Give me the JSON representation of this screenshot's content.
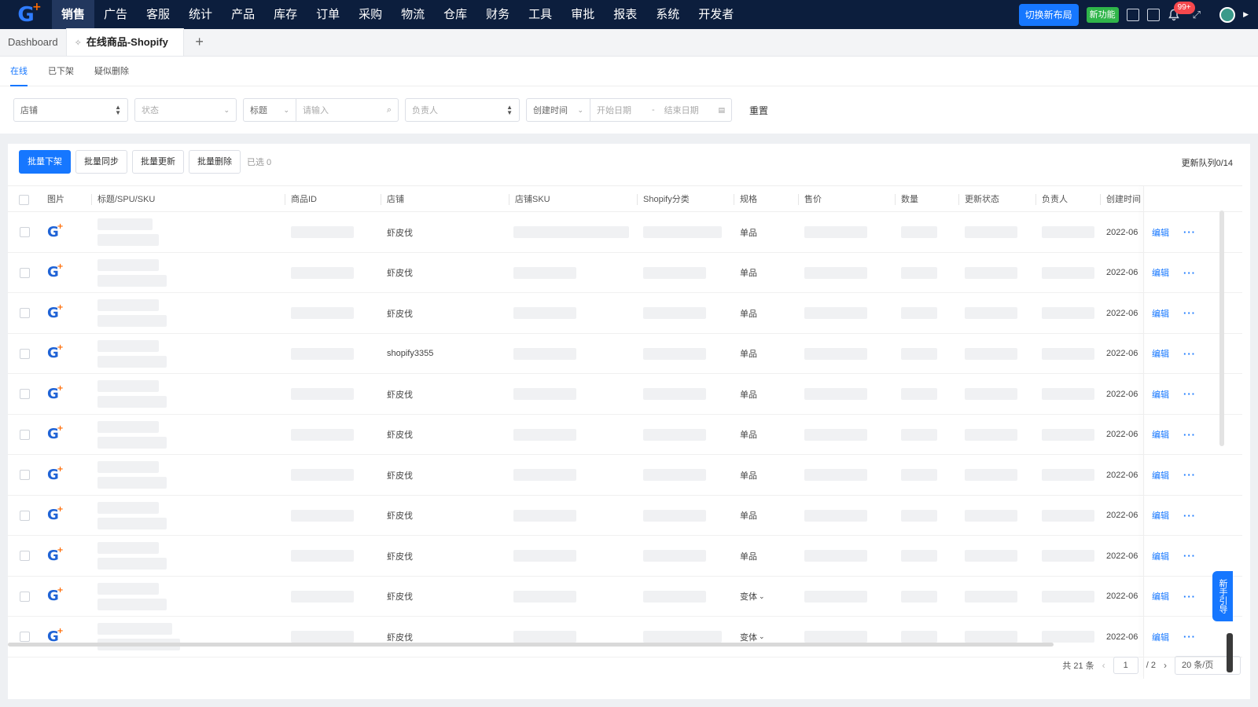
{
  "topnav": {
    "logo_text": "G",
    "menu": [
      "销售",
      "广告",
      "客服",
      "统计",
      "产品",
      "库存",
      "订单",
      "采购",
      "物流",
      "仓库",
      "财务",
      "工具",
      "审批",
      "报表",
      "系统",
      "开发者"
    ],
    "active_menu": "销售",
    "switch_layout": "切换新布局",
    "new_feature": "新功能",
    "notification_badge": "99+"
  },
  "tabs": {
    "dashboard": "Dashboard",
    "current": "在线商品-Shopify",
    "add": "+"
  },
  "subtabs": [
    "在线",
    "已下架",
    "疑似删除"
  ],
  "filters": {
    "store": "店铺",
    "status_placeholder": "状态",
    "title_select": "标题",
    "search_placeholder": "请输入",
    "owner": "负责人",
    "time_type": "创建时间",
    "start_date": "开始日期",
    "date_sep": "-",
    "end_date": "结束日期",
    "reset": "重置"
  },
  "toolbar": {
    "batch_offline": "批量下架",
    "batch_sync": "批量同步",
    "batch_update": "批量更新",
    "batch_delete": "批量删除",
    "selected": "已选 0",
    "queue": "更新队列0/14"
  },
  "columns": [
    "图片",
    "标题/SPU/SKU",
    "商品ID",
    "店铺",
    "店铺SKU",
    "Shopify分类",
    "规格",
    "售价",
    "数量",
    "更新状态",
    "负责人",
    "创建时间"
  ],
  "rows": [
    {
      "store": "虾皮伐",
      "spec": "单品",
      "created": "2022-06"
    },
    {
      "store": "虾皮伐",
      "spec": "单品",
      "created": "2022-06"
    },
    {
      "store": "虾皮伐",
      "spec": "单品",
      "created": "2022-06"
    },
    {
      "store": "shopify3355",
      "spec": "单品",
      "created": "2022-06"
    },
    {
      "store": "虾皮伐",
      "spec": "单品",
      "created": "2022-06"
    },
    {
      "store": "虾皮伐",
      "spec": "单品",
      "created": "2022-06"
    },
    {
      "store": "虾皮伐",
      "spec": "单品",
      "created": "2022-06"
    },
    {
      "store": "虾皮伐",
      "spec": "单品",
      "created": "2022-06"
    },
    {
      "store": "虾皮伐",
      "spec": "单品",
      "created": "2022-06"
    },
    {
      "store": "虾皮伐",
      "spec": "变体",
      "created": "2022-06"
    },
    {
      "store": "虾皮伐",
      "spec": "变体",
      "created": "2022-06"
    }
  ],
  "row_actions": {
    "edit": "编辑",
    "more": "···"
  },
  "pagination": {
    "total": "共 21 条",
    "current": "1",
    "pages": "/  2",
    "page_size": "20 条/页"
  },
  "guide": "新手引导",
  "colors": {
    "nav_bg": "#0c1e3d",
    "primary": "#1677ff",
    "new_feature": "#2fb54a",
    "badge": "#f5484d"
  }
}
